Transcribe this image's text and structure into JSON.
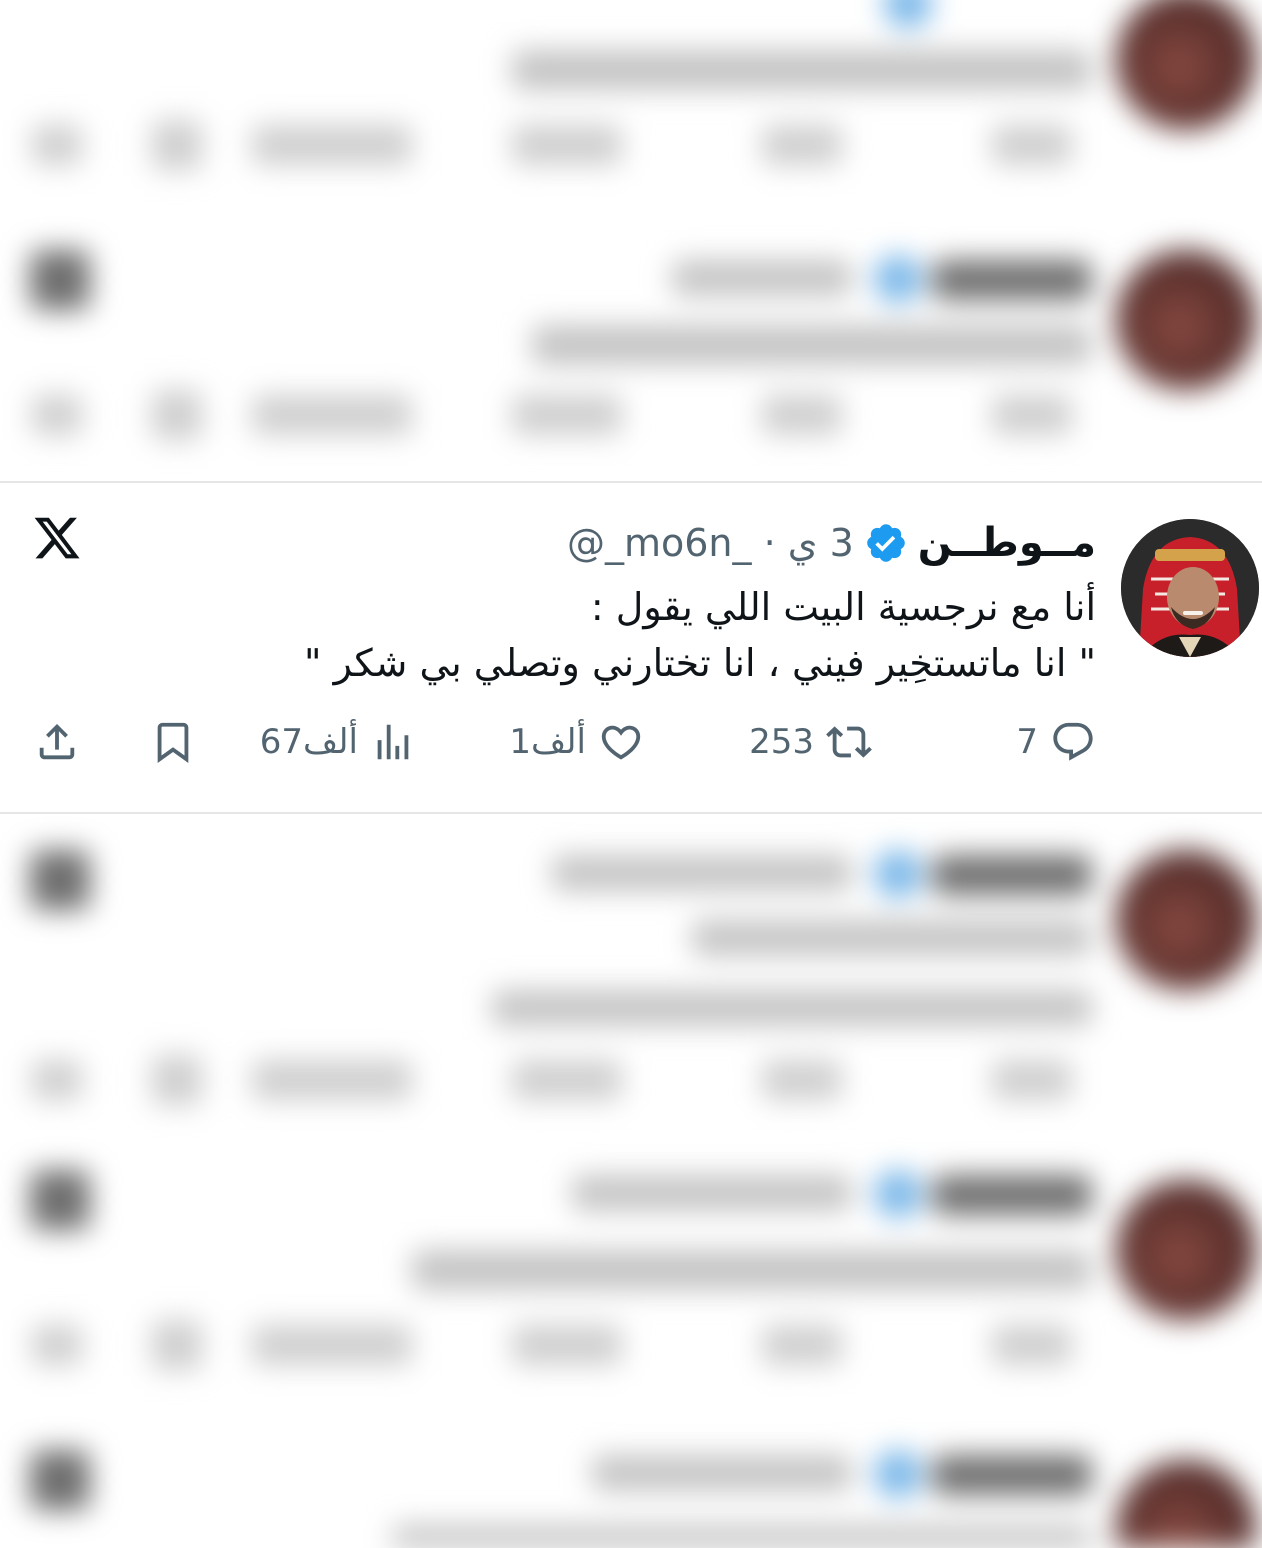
{
  "tweet": {
    "display_name": "مــوطــن",
    "handle": "@_mo6n_",
    "separator": "·",
    "time": "3 ي",
    "text_lines": [
      "أنا مع نرجسية البيت اللي يقول :",
      "\" انا ماتستخِير فيني ، انا تختارني وتصلي بي شكر \""
    ],
    "replies": "7",
    "reposts": "253",
    "likes": "1ألف",
    "views": "67ألف"
  },
  "colors": {
    "text": "#0f1419",
    "secondary": "#536471",
    "verified": "#1d9bf0",
    "separator": "#e6e6e6"
  },
  "icons": [
    "x-logo-icon",
    "verified-badge-icon",
    "reply-icon",
    "repost-icon",
    "like-icon",
    "views-icon",
    "bookmark-icon",
    "share-icon"
  ]
}
